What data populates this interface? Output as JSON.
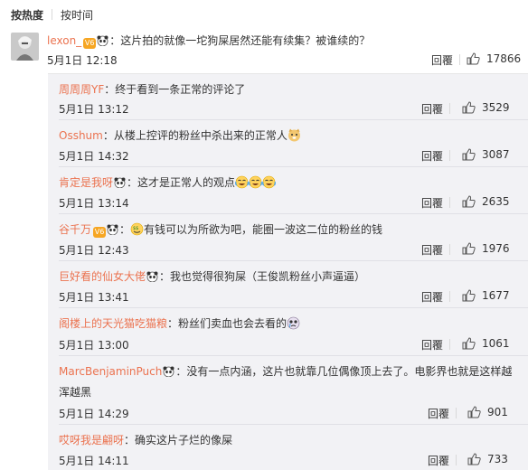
{
  "sort": {
    "hot": "按热度",
    "time": "按时间"
  },
  "main": {
    "user": "lexon_",
    "badge": "V6",
    "content": "：这片拍的就像一坨狗屎居然还能有续集？被谁续的？",
    "time": "5月1日 12:18",
    "reply": "回覆",
    "likes": "17866"
  },
  "replies": [
    {
      "user": "周周周YF",
      "content": "：终于看到一条正常的评论了",
      "time": "5月1日 13:12",
      "reply": "回覆",
      "likes": "3529"
    },
    {
      "user": "Osshum",
      "content": "：从楼上控评的粉丝中杀出来的正常人",
      "time": "5月1日 14:32",
      "reply": "回覆",
      "likes": "3087"
    },
    {
      "user": "肯定是我呀",
      "content": "：这才是正常人的观点",
      "time": "5月1日 13:14",
      "reply": "回覆",
      "likes": "2635"
    },
    {
      "user": "谷千万",
      "badge": "V6",
      "content": "有钱可以为所欲为吧，能圈一波这二位的粉丝的钱",
      "time": "5月1日 12:43",
      "reply": "回覆",
      "likes": "1976"
    },
    {
      "user": "巨好看的仙女大佬",
      "content": "：我也觉得很狗屎（王俊凯粉丝小声逼逼）",
      "time": "5月1日 13:41",
      "reply": "回覆",
      "likes": "1677"
    },
    {
      "user": "阁楼上的天光猫吃猫粮",
      "content": "：粉丝们卖血也会去看的",
      "time": "5月1日 13:00",
      "reply": "回覆",
      "likes": "1061"
    },
    {
      "user": "MarcBenjaminPuch",
      "content": "：没有一点内涵，这片也就靠几位偶像顶上去了。电影界也就是这样越",
      "content2": "浑越黑",
      "time": "5月1日 14:29",
      "reply": "回覆",
      "likes": "901"
    },
    {
      "user": "哎呀我是翩呀",
      "content": "：确实这片子烂的像屎",
      "time": "5月1日 14:11",
      "reply": "回覆",
      "likes": "733"
    }
  ],
  "colors": {
    "username": "#eb7350",
    "sub_bg": "#f2f2f5",
    "badge": "#f6a623"
  }
}
